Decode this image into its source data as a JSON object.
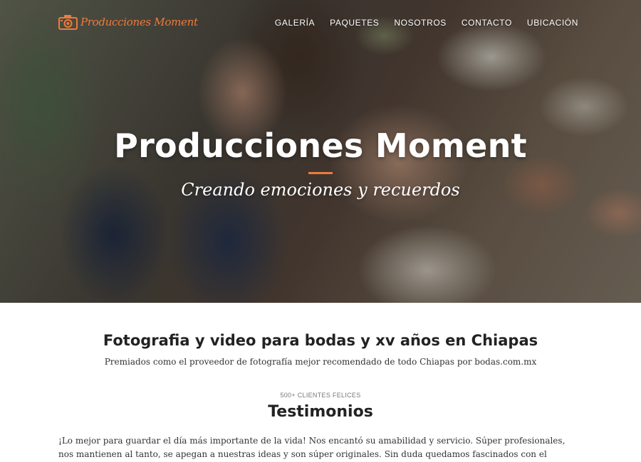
{
  "brand": {
    "name": "Producciones Moment",
    "logo_icon": "camera-icon",
    "accent_color": "#f07a3c"
  },
  "nav": {
    "items": [
      {
        "label": "GALERÍA"
      },
      {
        "label": "PAQUETES"
      },
      {
        "label": "NOSOTROS"
      },
      {
        "label": "CONTACTO"
      },
      {
        "label": "UBICACIÓN"
      }
    ]
  },
  "hero": {
    "title": "Producciones Moment",
    "subtitle": "Creando emociones y recuerdos"
  },
  "intro": {
    "heading": "Fotografia y video para bodas y xv años en Chiapas",
    "text": "Premiados como el proveedor de fotografía mejor recomendado de todo Chiapas por bodas.com.mx"
  },
  "testimonials": {
    "eyebrow": "500+ CLIENTES FELICES",
    "title": "Testimonios",
    "quote": "¡Lo mejor para guardar el día más importante de la vida! Nos encantó su amabilidad y servicio. Súper profesionales, nos mantienen al tanto, se apegan a nuestras ideas y son súper originales. Sin duda quedamos fascinados con el trabajo."
  }
}
